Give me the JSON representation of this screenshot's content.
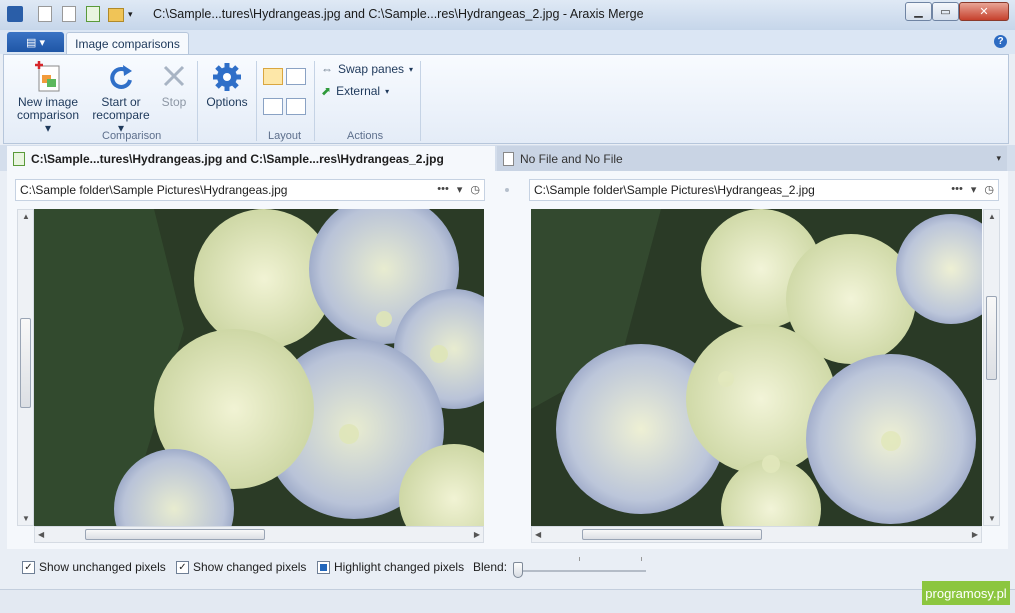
{
  "window": {
    "title": "C:\\Sample...tures\\Hydrangeas.jpg and C:\\Sample...res\\Hydrangeas_2.jpg - Araxis Merge",
    "minimize_icon": "minimize-icon",
    "maximize_icon": "maximize-icon",
    "close_icon": "close-icon"
  },
  "ribbon": {
    "tab_label": "Image comparisons",
    "new_image_label_1": "New image",
    "new_image_label_2": "comparison",
    "start_label_1": "Start or",
    "start_label_2": "recompare",
    "stop_label": "Stop",
    "options_label": "Options",
    "group_comparison": "Comparison",
    "group_layout": "Layout",
    "group_actions": "Actions",
    "swap_panes_label": "Swap panes",
    "external_label": "External"
  },
  "doc_tabs": {
    "active": "C:\\Sample...tures\\Hydrangeas.jpg and C:\\Sample...res\\Hydrangeas_2.jpg",
    "inactive": "No File and No File"
  },
  "left_pane": {
    "path": "C:\\Sample folder\\Sample Pictures\\Hydrangeas.jpg"
  },
  "right_pane": {
    "path": "C:\\Sample folder\\Sample Pictures\\Hydrangeas_2.jpg"
  },
  "bottom": {
    "show_unchanged": "Show unchanged pixels",
    "show_changed": "Show changed pixels",
    "highlight_changed": "Highlight changed pixels",
    "blend_label": "Blend:"
  },
  "watermark": "programosy.pl",
  "colors": {
    "accent": "#2d6bc2",
    "ribbon_bg": "#e4ecf7",
    "watermark_bg": "#8cc63f"
  }
}
